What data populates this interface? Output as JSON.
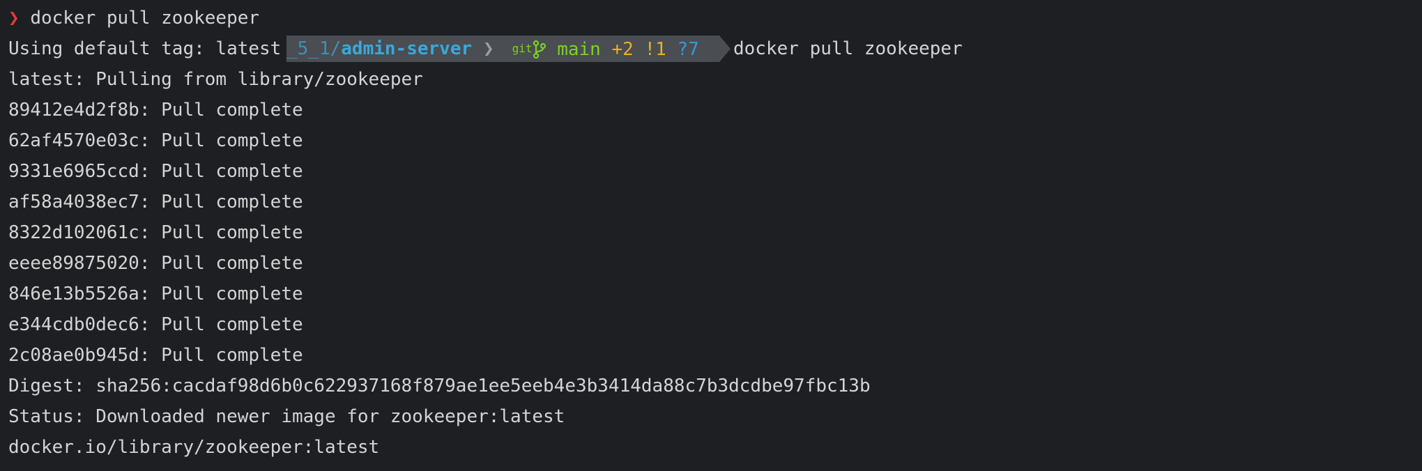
{
  "prompt": {
    "arrow": "❯",
    "command": "docker pull zookeeper"
  },
  "powerline": {
    "dir_prefix": "_5_1/",
    "dir_name": "admin-server",
    "separator": "❯",
    "git_label": "git",
    "branch_icon": "branch-icon",
    "branch": "main",
    "staged": "+2",
    "modified": "!1",
    "untracked": "?7",
    "command": "docker pull zookeeper"
  },
  "output": {
    "line1": "Using default tag: latest",
    "line2": "latest: Pulling from library/zookeeper",
    "layers": [
      "89412e4d2f8b: Pull complete",
      "62af4570e03c: Pull complete",
      "9331e6965ccd: Pull complete",
      "af58a4038ec7: Pull complete",
      "8322d102061c: Pull complete",
      "eeee89875020: Pull complete",
      "846e13b5526a: Pull complete",
      "e344cdb0dec6: Pull complete",
      "2c08ae0b945d: Pull complete"
    ],
    "digest": "Digest: sha256:cacdaf98d6b0c622937168f879ae1ee5eeb4e3b3414da88c7b3dcdbe97fbc13b",
    "status": "Status: Downloaded newer image for zookeeper:latest",
    "image_ref": "docker.io/library/zookeeper:latest"
  },
  "colors": {
    "background": "#1e1f22",
    "text": "#d4d4d4",
    "prompt_arrow": "#e83b36",
    "segment_bg": "#4a4d52",
    "dir": "#3aa8d8",
    "git_green": "#7bd324",
    "git_yellow": "#e8b21c",
    "git_blue": "#2e9ce0"
  }
}
